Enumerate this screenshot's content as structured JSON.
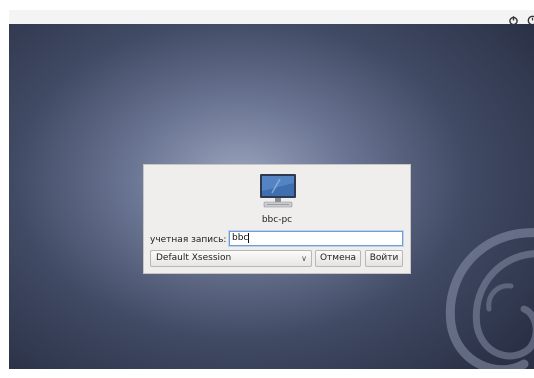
{
  "topbar": {
    "icons": [
      "power-icon",
      "clock-icon"
    ]
  },
  "login": {
    "hostname": "bbc-pc",
    "username_label": "учетная запись:",
    "username_value": "bbc",
    "session_selected": "Default Xsession",
    "cancel_label": "Отмена",
    "login_label": "Войти"
  },
  "colors": {
    "desktop_center": "#9aa4bd",
    "desktop_edge": "#2a3146",
    "dialog_bg": "#efeeec",
    "focus_border": "#6f9ed6"
  }
}
